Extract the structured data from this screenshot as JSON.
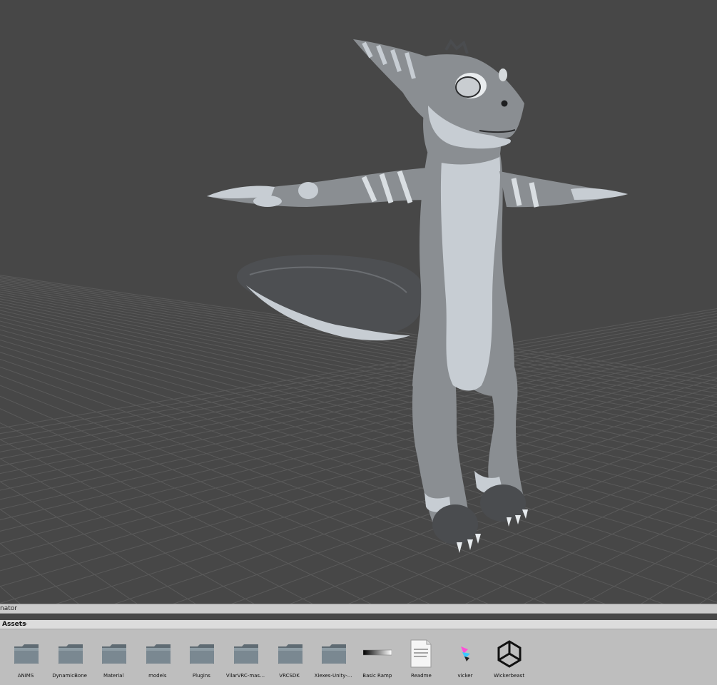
{
  "scene": {
    "background_color": "#474747",
    "grid_color": "#5a5a5a",
    "model_main_color": "#8a8e92",
    "model_light_color": "#c7cdd3",
    "model_dark_color": "#4a4c4f"
  },
  "animator_tab": {
    "label": "nator"
  },
  "project_browser": {
    "breadcrumb": "Assets",
    "items": [
      {
        "label": "ANIMS",
        "icon": "folder-icon"
      },
      {
        "label": "DynamicBone",
        "icon": "folder-icon"
      },
      {
        "label": "Material",
        "icon": "folder-icon"
      },
      {
        "label": "models",
        "icon": "folder-icon"
      },
      {
        "label": "Plugins",
        "icon": "folder-icon"
      },
      {
        "label": "VilarVRC-mas…",
        "icon": "folder-icon"
      },
      {
        "label": "VRCSDK",
        "icon": "folder-icon"
      },
      {
        "label": "Xiexes-Unity-…",
        "icon": "folder-icon"
      },
      {
        "label": "Basic Ramp",
        "icon": "gradient-texture-icon"
      },
      {
        "label": "Readme",
        "icon": "text-document-icon"
      },
      {
        "label": "vicker",
        "icon": "image-texture-icon"
      },
      {
        "label": "Wickerbeast",
        "icon": "unity-scene-icon"
      }
    ]
  }
}
